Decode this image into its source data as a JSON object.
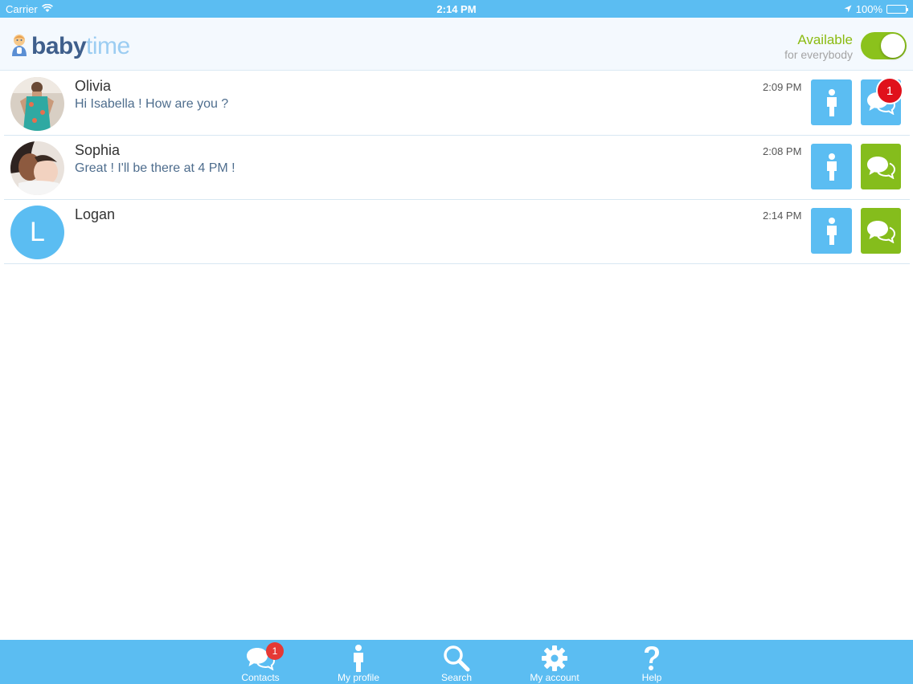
{
  "status_bar": {
    "carrier": "Carrier",
    "time": "2:14 PM",
    "battery": "100%"
  },
  "header": {
    "logo_part1": "baby",
    "logo_part2": "time",
    "availability_title": "Available",
    "availability_subtitle": "for everybody",
    "available_toggle_on": true
  },
  "conversations": [
    {
      "name": "Olivia",
      "message": "Hi Isabella ! How are you ?",
      "time": "2:09 PM",
      "unread": "1",
      "chat_color": "blue"
    },
    {
      "name": "Sophia",
      "message": "Great ! I'll be there at 4 PM !",
      "time": "2:08 PM",
      "chat_color": "green"
    },
    {
      "name": "Logan",
      "message": "",
      "time": "2:14 PM",
      "avatar_letter": "L",
      "chat_color": "green"
    }
  ],
  "tab_bar": {
    "tabs": [
      {
        "label": "Contacts",
        "icon": "chat-bubbles-icon",
        "badge": "1"
      },
      {
        "label": "My profile",
        "icon": "person-icon"
      },
      {
        "label": "Search",
        "icon": "search-icon"
      },
      {
        "label": "My account",
        "icon": "gear-icon"
      },
      {
        "label": "Help",
        "icon": "help-icon"
      }
    ]
  },
  "colors": {
    "accent_blue": "#5bbdf2",
    "accent_green": "#85bd1c",
    "badge_red": "#e0111b",
    "logo_dark": "#3f5f8c",
    "logo_light": "#9ccdf2"
  }
}
